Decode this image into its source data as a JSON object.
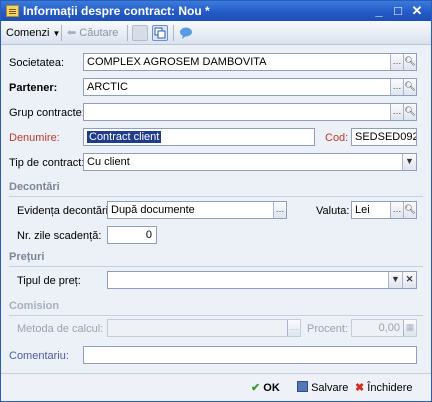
{
  "window": {
    "title": "Informații despre contract: Nou *",
    "minimize": "_",
    "maximize": "□",
    "close": "✕"
  },
  "toolbar": {
    "commands_label": "Comenzi",
    "search_label": "Căutare"
  },
  "form": {
    "company_label": "Societatea:",
    "company_value": "COMPLEX AGROSEM DAMBOVITA",
    "partner_label": "Partener:",
    "partner_value": "ARCTIC",
    "group_label": "Grup contracte:",
    "group_value": "",
    "name_label": "Denumire:",
    "name_value": "Contract client",
    "code_label": "Cod:",
    "code_value": "SEDSED092",
    "type_label": "Tip de contract:",
    "type_value": "Cu client"
  },
  "settlement": {
    "section_title": "Decontări",
    "record_label": "Evidența decontări:",
    "record_value": "După documente",
    "currency_label": "Valuta:",
    "currency_value": "Lei",
    "days_label": "Nr. zile scadență:",
    "days_value": "0"
  },
  "prices": {
    "section_title": "Prețuri",
    "price_type_label": "Tipul de preț:",
    "price_type_value": ""
  },
  "commission": {
    "section_title": "Comision",
    "method_label": "Metoda de calcul:",
    "method_value": "",
    "percent_label": "Procent:",
    "percent_value": "0,00"
  },
  "comment": {
    "label": "Comentariu:",
    "value": ""
  },
  "buttons": {
    "ok": "OK",
    "save": "Salvare",
    "close": "Închidere"
  },
  "colors": {
    "titlebar": "#2358c4",
    "required_label": "#c0392b",
    "section_title": "#7b8698"
  }
}
